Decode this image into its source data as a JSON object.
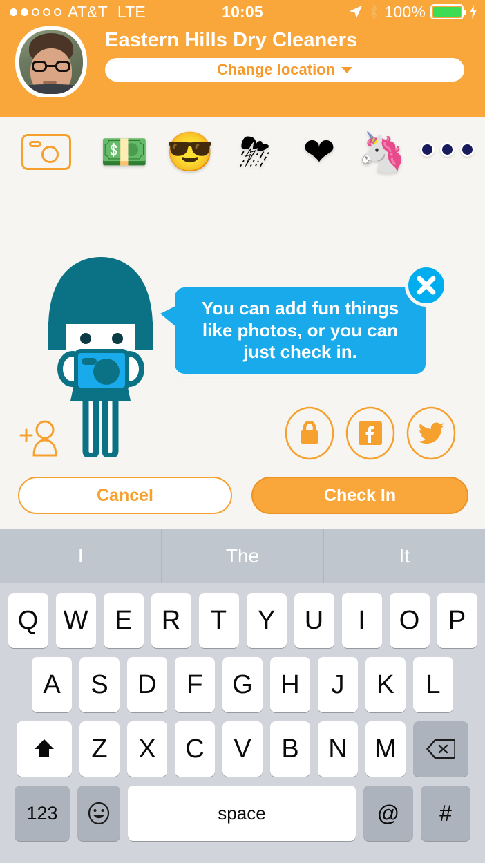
{
  "status_bar": {
    "signal_dots_total": 5,
    "signal_dots_filled": 2,
    "carrier": "AT&T",
    "network": "LTE",
    "time": "10:05",
    "battery_percent": "100%",
    "battery_color": "#3DDC54",
    "icons": [
      "location-arrow-icon",
      "bluetooth-icon",
      "battery-icon",
      "charging-bolt-icon"
    ]
  },
  "header": {
    "background_color": "#F9A63A",
    "venue_name": "Eastern Hills Dry Cleaners",
    "change_location_label": "Change location",
    "avatar_name": "user-avatar"
  },
  "sticker_bar": {
    "camera_label": "camera-icon",
    "stickers": [
      {
        "name": "money-sticker",
        "glyph": "💵"
      },
      {
        "name": "sun-sunglasses-sticker",
        "glyph": "😎"
      },
      {
        "name": "storm-cloud-sticker",
        "glyph": "⛈"
      },
      {
        "name": "heart-sticker",
        "glyph": "❤"
      },
      {
        "name": "unicorn-sticker",
        "glyph": "🦄"
      }
    ],
    "more_label": "more-stickers-icon"
  },
  "tooltip": {
    "message": "You can add fun things like photos, or you can just check in.",
    "bubble_color": "#18AAEA",
    "close_label": "close-tooltip"
  },
  "privacy": {
    "options": [
      {
        "name": "privacy-lock-button",
        "icon": "lock-icon"
      },
      {
        "name": "share-facebook-button",
        "icon": "facebook-icon"
      },
      {
        "name": "share-twitter-button",
        "icon": "twitter-icon"
      }
    ],
    "accent_color": "#F6A02E"
  },
  "add_friend": {
    "label": "add-friend-icon"
  },
  "actions": {
    "cancel_label": "Cancel",
    "checkin_label": "Check In",
    "cancel_color": "#F6A02E",
    "checkin_color": "#F9A63A"
  },
  "keyboard": {
    "predictions": [
      "I",
      "The",
      "It"
    ],
    "row1": [
      "Q",
      "W",
      "E",
      "R",
      "T",
      "Y",
      "U",
      "I",
      "O",
      "P"
    ],
    "row2": [
      "A",
      "S",
      "D",
      "F",
      "G",
      "H",
      "J",
      "K",
      "L"
    ],
    "row3": [
      "Z",
      "X",
      "C",
      "V",
      "B",
      "N",
      "M"
    ],
    "shift_label": "shift-key",
    "delete_label": "delete-key",
    "numbers_label": "123",
    "emoji_label": "emoji-key",
    "space_label": "space",
    "at_label": "@",
    "hash_label": "#"
  }
}
